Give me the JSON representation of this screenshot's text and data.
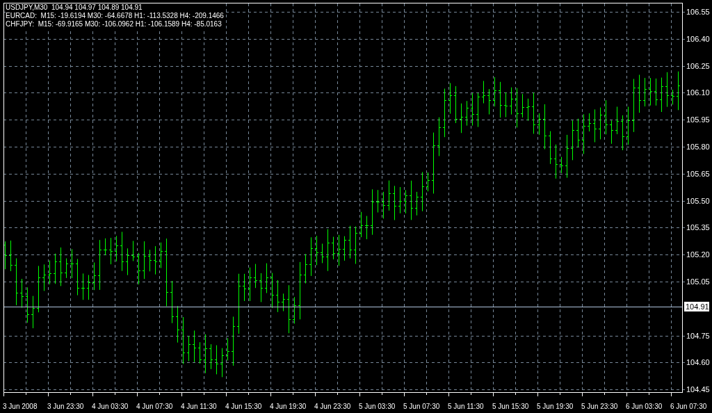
{
  "legend": [
    "USDJPY,M30  104.94 104.97 104.89 104.91",
    "EURCAD:  M15: -19.6194 M30: -64.6678 H1: -113.5328 H4: -209.1466",
    "CHFJPY:  M15: -69.9165 M30: -106.0962 H1: -106.1589 H4: -85.0163"
  ],
  "price_axis": [
    "106.55",
    "106.40",
    "106.25",
    "106.10",
    "105.95",
    "105.80",
    "105.65",
    "105.50",
    "105.35",
    "105.20",
    "105.05",
    "104.75",
    "104.60",
    "104.45"
  ],
  "current_price": "104.91",
  "time_axis": [
    "3 Jun 2008",
    "3 Jun 23:30",
    "4 Jun 03:30",
    "4 Jun 07:30",
    "4 Jun 11:30",
    "4 Jun 15:30",
    "4 Jun 19:30",
    "4 Jun 23:30",
    "5 Jun 03:30",
    "5 Jun 07:30",
    "5 Jun 11:30",
    "5 Jun 15:30",
    "5 Jun 19:30",
    "5 Jun 23:30",
    "6 Jun 03:30",
    "6 Jun 07:30"
  ]
}
